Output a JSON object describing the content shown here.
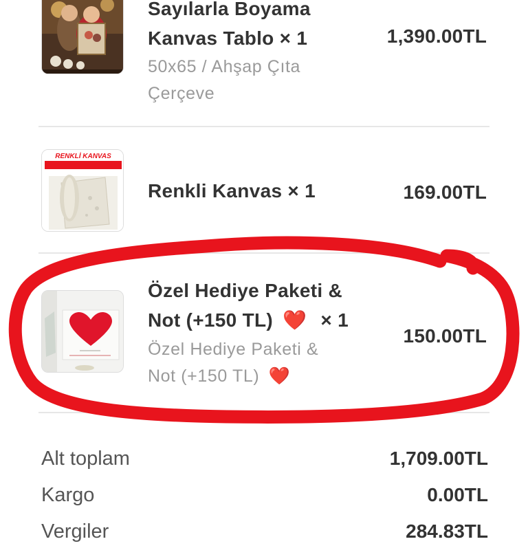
{
  "items": [
    {
      "title_line1": "Sayılarla Boyama",
      "title_line2": "Kanvas Tablo × 1",
      "variant_line1": "50x65 / Ahşap Çıta",
      "variant_line2": "Çerçeve",
      "price": "1,390.00TL",
      "thumbnail_icon": "couple-painting-photo"
    },
    {
      "title": "Renkli Kanvas × 1",
      "price": "169.00TL",
      "thumbnail_banner": "RENKLİ KANVAS",
      "thumbnail_icon": "canvas-roll-photo"
    },
    {
      "title_line1": "Özel Hediye Paketi &",
      "title_line2": "Not (+150 TL)",
      "heart": "❤️",
      "qty": "× 1",
      "variant_line1": "Özel Hediye Paketi &",
      "variant_line2": "Not (+150 TL)",
      "price": "150.00TL",
      "thumbnail_icon": "heart-gift-card-photo"
    }
  ],
  "summary": {
    "subtotal_label": "Alt toplam",
    "subtotal_value": "1,709.00TL",
    "shipping_label": "Kargo",
    "shipping_value": "0.00TL",
    "tax_label": "Vergiler",
    "tax_value": "284.83TL"
  },
  "colors": {
    "annotation": "#e8141d",
    "divider": "#e6e6e6",
    "heart": "#e0152b"
  }
}
